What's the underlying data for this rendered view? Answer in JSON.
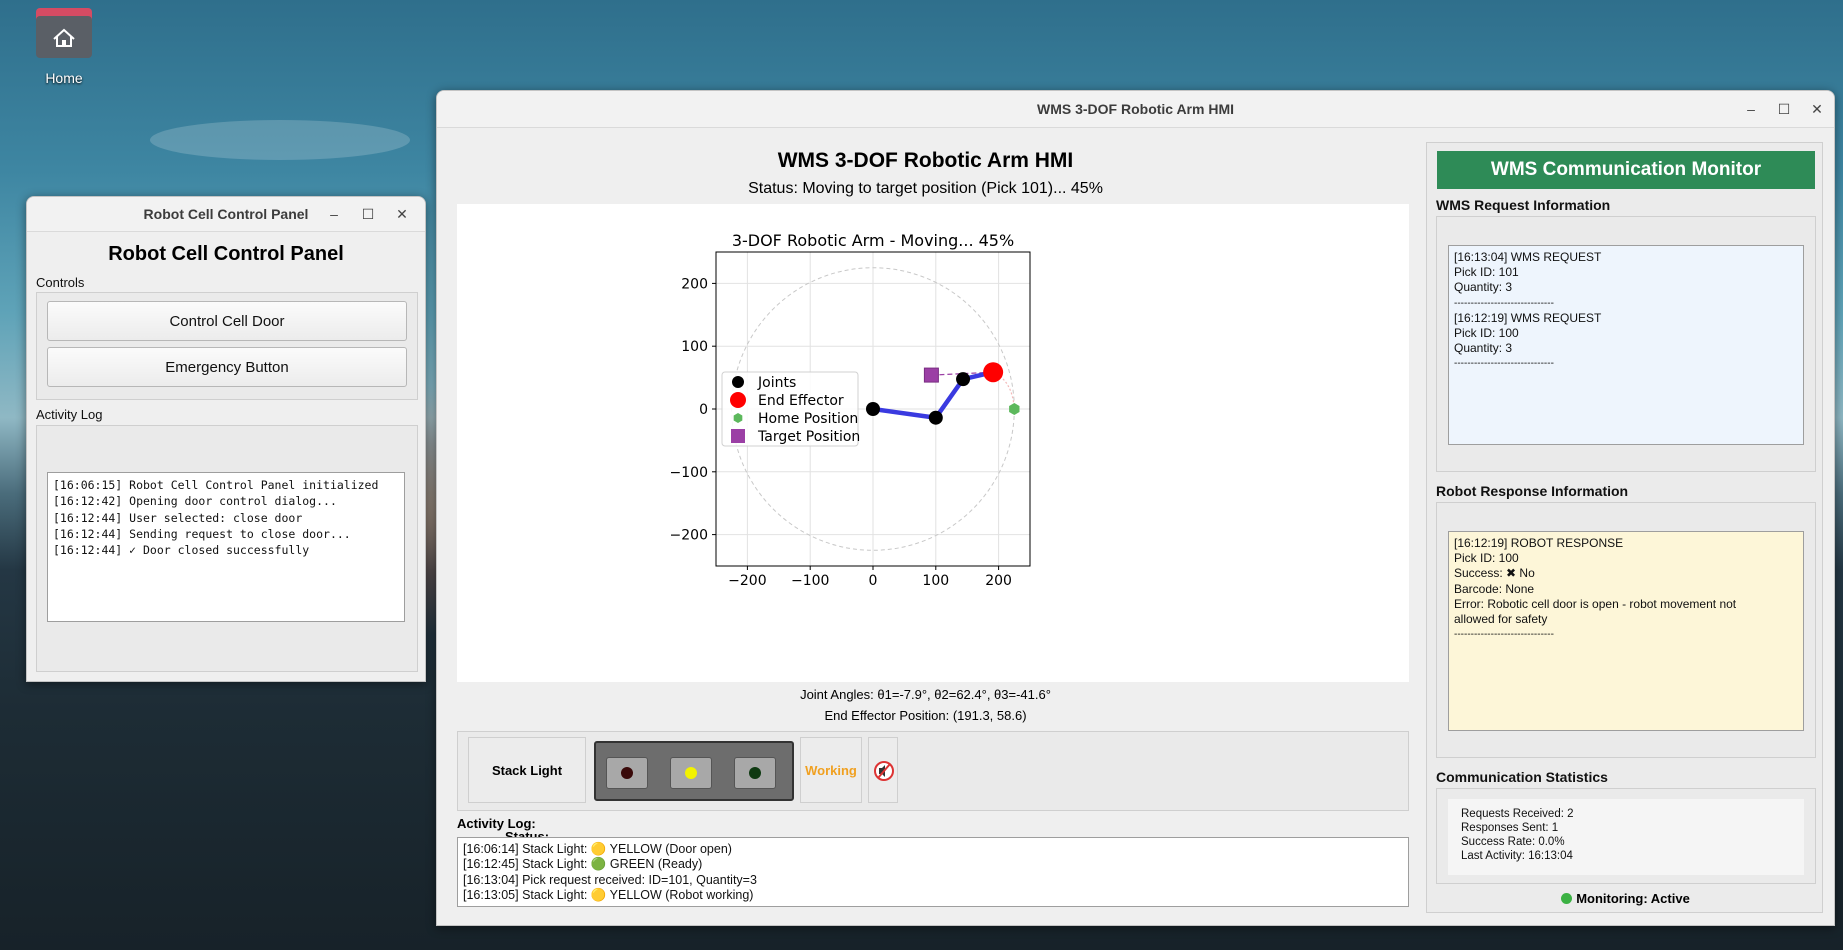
{
  "desktop": {
    "home_label": "Home"
  },
  "control_panel": {
    "window_title": "Robot Cell Control Panel",
    "heading": "Robot Cell Control Panel",
    "controls_label": "Controls",
    "door_button": "Control Cell Door",
    "emergency_button": "Emergency Button",
    "log_label": "Activity Log",
    "log_lines": [
      "[16:06:15] Robot Cell Control Panel initialized",
      "[16:12:42] Opening door control dialog...",
      "[16:12:44] User selected: close door",
      "[16:12:44] Sending request to close door...",
      "[16:12:44] ✓ Door closed successfully"
    ]
  },
  "hmi": {
    "window_title": "WMS 3-DOF Robotic Arm HMI",
    "heading": "WMS 3-DOF Robotic Arm HMI",
    "status": "Status: Moving to target position (Pick 101)... 45%",
    "joint_angles": "Joint Angles: θ1=-7.9°, θ2=62.4°, θ3=-41.6°",
    "end_effector": "End Effector Position: (191.3, 58.6)",
    "stack_light_label": "Stack Light Status:",
    "stack_state": "Working",
    "mute_icon": "speaker-muted-icon",
    "lights": [
      {
        "name": "red",
        "color": "#3a0a0a"
      },
      {
        "name": "yellow",
        "color": "#f2f200"
      },
      {
        "name": "green",
        "color": "#0f3a12"
      }
    ],
    "log_label": "Activity Log:",
    "log_lines": [
      "[16:06:14] Stack Light: 🟡 YELLOW (Door open)",
      "[16:12:45] Stack Light: 🟢 GREEN (Ready)",
      "[16:13:04] Pick request received: ID=101, Quantity=3",
      "[16:13:05] Stack Light: 🟡 YELLOW (Robot working)"
    ]
  },
  "monitor": {
    "header": "WMS Communication Monitor",
    "request_title": "WMS Request Information",
    "request_lines": [
      "[16:13:04] WMS REQUEST",
      "Pick ID: 101",
      "Quantity: 3",
      "------------------------------",
      "[16:12:19] WMS REQUEST",
      "Pick ID: 100",
      "Quantity: 3",
      "------------------------------"
    ],
    "response_title": "Robot Response Information",
    "response_lines": [
      "[16:12:19] ROBOT RESPONSE",
      "Pick ID: 100",
      "Success: ✖ No",
      "Barcode: None",
      "Error: Robotic cell door is open - robot movement not",
      "allowed for safety",
      "------------------------------"
    ],
    "stats_title": "Communication Statistics",
    "stats_lines": [
      "Requests Received: 2",
      "Responses Sent: 1",
      "Success Rate: 0.0%",
      "Last Activity: 16:13:04"
    ],
    "monitoring_status": "Monitoring: Active",
    "monitoring_color": "#3bb143",
    "header_color": "#2e8b57"
  },
  "chart_data": {
    "type": "scatter",
    "title": "3-DOF Robotic Arm - Moving... 45%",
    "xlim": [
      -250,
      250
    ],
    "ylim": [
      -250,
      250
    ],
    "x_ticks": [
      -200,
      -100,
      0,
      100,
      200
    ],
    "y_ticks": [
      -200,
      -100,
      0,
      100,
      200
    ],
    "grid": true,
    "workspace_radius": 225,
    "arm_joints": [
      [
        0,
        0
      ],
      [
        100,
        -13.9
      ],
      [
        143.4,
        47.5
      ],
      [
        191.3,
        58.6
      ]
    ],
    "end_effector": [
      191.3,
      58.6
    ],
    "home_position": [
      225,
      0
    ],
    "target_position": [
      93,
      54
    ],
    "legend": [
      "Joints",
      "End Effector",
      "Home Position",
      "Target Position"
    ],
    "legend_position": "center-left",
    "colors": {
      "arm": "#3a3ae0",
      "joint": "#000000",
      "end_effector": "#ff0000",
      "home": "#5cb85c",
      "target": "#9b3fa5"
    }
  }
}
